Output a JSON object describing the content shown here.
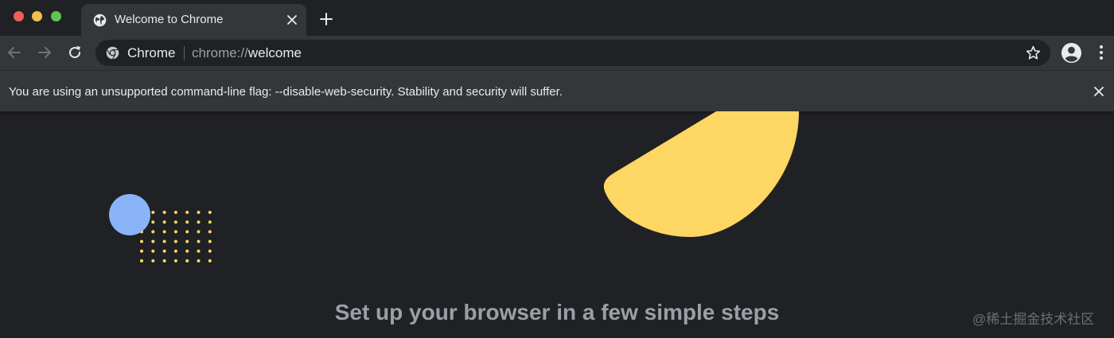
{
  "window": {
    "controls": [
      "close",
      "minimize",
      "maximize"
    ]
  },
  "tabs": [
    {
      "title": "Welcome to Chrome",
      "favicon": "globe-icon",
      "active": true
    }
  ],
  "toolbar": {
    "back_icon": "back-arrow-icon",
    "forward_icon": "forward-arrow-icon",
    "reload_icon": "reload-icon",
    "omnibox": {
      "site_label": "Chrome",
      "url_scheme": "chrome://",
      "url_host": "welcome"
    },
    "bookmark_icon": "star-icon",
    "profile_icon": "profile-avatar-icon",
    "menu_icon": "kebab-menu-icon"
  },
  "infobar": {
    "message": "You are using an unsupported command-line flag: --disable-web-security. Stability and security will suffer."
  },
  "content": {
    "headline": "Set up your browser in a few simple steps",
    "watermark": "@稀土掘金技术社区"
  },
  "colors": {
    "background": "#202124",
    "toolbar": "#35363a",
    "text": "#e8eaed",
    "muted_text": "#9aa0a6",
    "blue_circle": "#8ab4f8",
    "yellow_shape": "#fdd663"
  }
}
